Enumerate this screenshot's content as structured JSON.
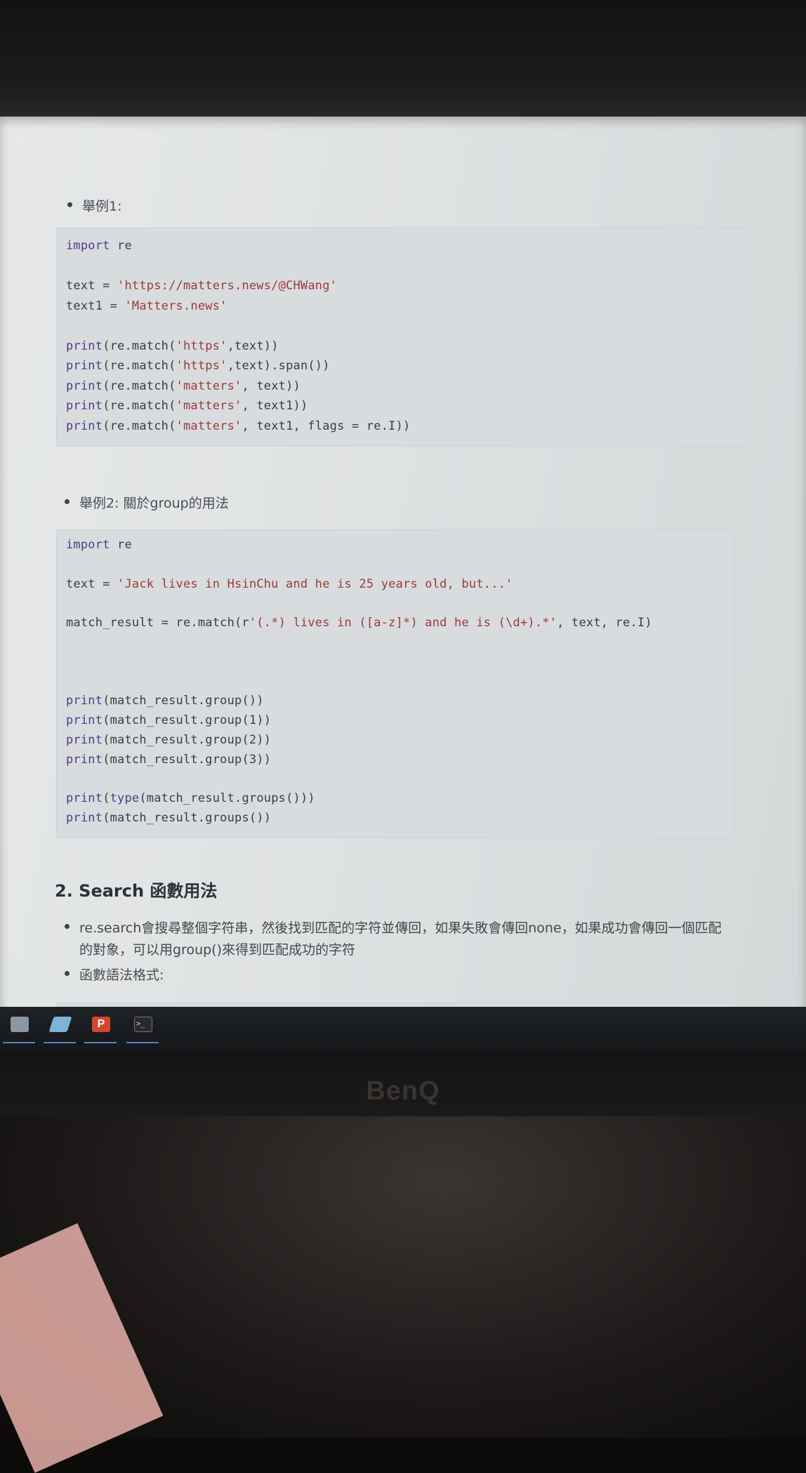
{
  "example1": {
    "heading": "舉例1:",
    "code": [
      [
        {
          "t": "import",
          "c": "kw"
        },
        {
          "t": " re"
        }
      ],
      [],
      [
        {
          "t": "text = "
        },
        {
          "t": "'https://matters.news/@CHWang'",
          "c": "str"
        }
      ],
      [
        {
          "t": "text1 = "
        },
        {
          "t": "'Matters.news'",
          "c": "str"
        }
      ],
      [],
      [
        {
          "t": "print",
          "c": "kw"
        },
        {
          "t": "(re.match("
        },
        {
          "t": "'https'",
          "c": "str"
        },
        {
          "t": ",text))"
        }
      ],
      [
        {
          "t": "print",
          "c": "kw"
        },
        {
          "t": "(re.match("
        },
        {
          "t": "'https'",
          "c": "str"
        },
        {
          "t": ",text).span())"
        }
      ],
      [
        {
          "t": "print",
          "c": "kw"
        },
        {
          "t": "(re.match("
        },
        {
          "t": "'matters'",
          "c": "str"
        },
        {
          "t": ", text))"
        }
      ],
      [
        {
          "t": "print",
          "c": "kw"
        },
        {
          "t": "(re.match("
        },
        {
          "t": "'matters'",
          "c": "str"
        },
        {
          "t": ", text1))"
        }
      ],
      [
        {
          "t": "print",
          "c": "kw"
        },
        {
          "t": "(re.match("
        },
        {
          "t": "'matters'",
          "c": "str"
        },
        {
          "t": ", text1, flags = re.I))"
        }
      ]
    ]
  },
  "example2": {
    "heading": "舉例2: 關於group的用法",
    "code": [
      [
        {
          "t": "import",
          "c": "kw"
        },
        {
          "t": " re"
        }
      ],
      [],
      [
        {
          "t": "text = "
        },
        {
          "t": "'Jack lives in HsinChu and he is 25 years old, but...'",
          "c": "str"
        }
      ],
      [],
      [
        {
          "t": "match_result = re.match(r"
        },
        {
          "t": "'(.*) lives in ([a-z]*) and he is (\\d+).*'",
          "c": "str"
        },
        {
          "t": ", text, re.I)"
        }
      ],
      [],
      [],
      [],
      [
        {
          "t": "print",
          "c": "kw"
        },
        {
          "t": "(match_result.group())"
        }
      ],
      [
        {
          "t": "print",
          "c": "kw"
        },
        {
          "t": "(match_result.group(1))"
        }
      ],
      [
        {
          "t": "print",
          "c": "kw"
        },
        {
          "t": "(match_result.group(2))"
        }
      ],
      [
        {
          "t": "print",
          "c": "kw"
        },
        {
          "t": "(match_result.group(3))"
        }
      ],
      [],
      [
        {
          "t": "print",
          "c": "kw"
        },
        {
          "t": "("
        },
        {
          "t": "type",
          "c": "kw"
        },
        {
          "t": "(match_result.groups()))"
        }
      ],
      [
        {
          "t": "print",
          "c": "kw"
        },
        {
          "t": "(match_result.groups())"
        }
      ]
    ]
  },
  "section": {
    "title": "2. Search 函數用法",
    "bullet1_line1": "re.search會搜尋整個字符串，然後找到匹配的字符並傳回，如果失敗會傳回none，如果成功會傳回一個匹配",
    "bullet1_line2": "的對象，可以用group()來得到匹配成功的字符",
    "bullet2": "函數語法格式:"
  },
  "taskbar": {
    "items": [
      {
        "name": "desktop-icon",
        "color": "#8c96a4"
      },
      {
        "name": "notes-icon",
        "color": "#7fb2d6"
      },
      {
        "name": "powerpoint-icon",
        "color": "#d2452f",
        "label": "P"
      },
      {
        "name": "terminal-icon",
        "color": "#2b2b2b",
        "label": ">_"
      }
    ]
  },
  "monitor": {
    "brand": "BenQ"
  }
}
